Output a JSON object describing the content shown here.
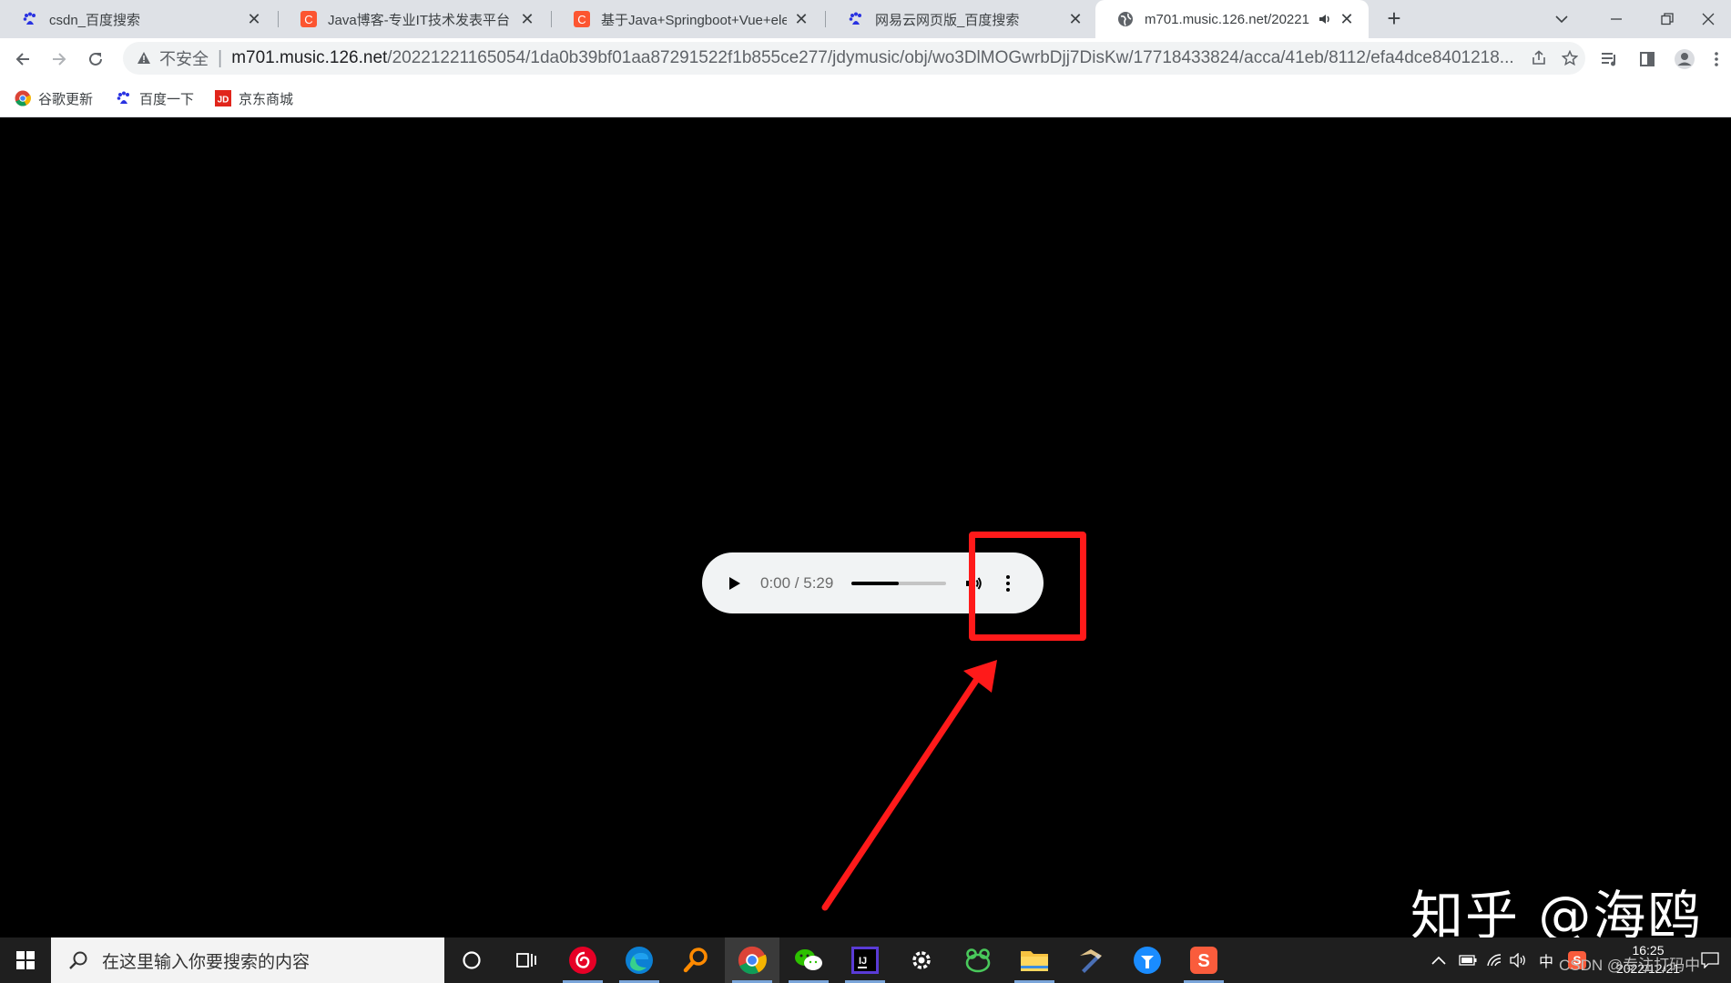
{
  "browser": {
    "tabs": [
      {
        "title": "csdn_百度搜索",
        "favicon": "baidu-icon",
        "active": false
      },
      {
        "title": "Java博客-专业IT技术发表平台",
        "favicon": "csdn-icon",
        "active": false
      },
      {
        "title": "基于Java+Springboot+Vue+ele",
        "favicon": "csdn-icon",
        "active": false
      },
      {
        "title": "网易云网页版_百度搜索",
        "favicon": "baidu-icon",
        "active": false
      },
      {
        "title": "m701.music.126.net/20221",
        "favicon": "globe-icon",
        "active": true
      }
    ],
    "close_glyph": "✕",
    "new_tab_glyph": "+",
    "address": {
      "security_label": "不安全",
      "url_host": "m701.music.126.net",
      "url_path": "/20221221165054/1da0b39bf01aa87291522f1b855ce277/jdymusic/obj/wo3DlMOGwrbDjj7DisKw/17718433824/acca/41eb/8112/efa4dce8401218..."
    },
    "bookmarks": [
      {
        "label": "谷歌更新",
        "icon": "chrome-icon"
      },
      {
        "label": "百度一下",
        "icon": "baidu-icon"
      },
      {
        "label": "京东商城",
        "icon": "jd-icon"
      }
    ]
  },
  "player": {
    "time": "0:00 / 5:29",
    "buffered_fraction": 0.5
  },
  "watermark": "知乎 @海鸥",
  "taskbar": {
    "search_placeholder": "在这里输入你要搜索的内容",
    "clock_time": "16:25",
    "clock_date": "2022/12/21",
    "ime_label": "中",
    "csdn_watermark": "CSDN @专注打码中",
    "apps": [
      "cortana-icon",
      "task-view-icon",
      "netease-music-icon",
      "edge-icon",
      "search-app-icon",
      "chrome-icon",
      "wechat-icon",
      "intellij-icon",
      "settings-icon",
      "frog-app-icon",
      "file-explorer-icon",
      "sketch-app-icon",
      "blue-app-icon",
      "sogou-icon"
    ]
  },
  "colors": {
    "annotation": "#ff1a1a",
    "tabstrip": "#dee1e6",
    "page_bg": "#000000",
    "taskbar": "#1f1f1f"
  }
}
